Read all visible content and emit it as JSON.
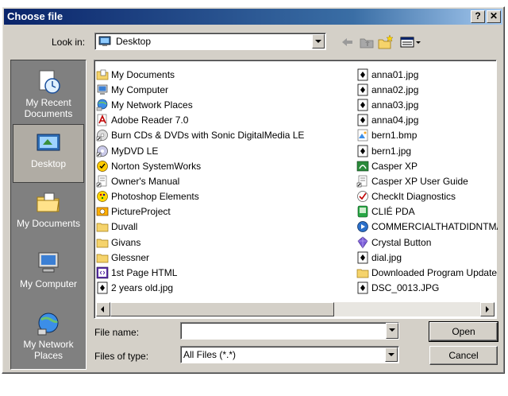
{
  "window": {
    "title": "Choose file",
    "help_label": "?",
    "close_label": "✕"
  },
  "lookin": {
    "label": "Look in:",
    "value": "Desktop"
  },
  "toolbar": {
    "icons": [
      "back-icon",
      "up-folder-icon",
      "new-folder-icon",
      "view-menu-icon"
    ]
  },
  "places": [
    {
      "label": "My Recent Documents",
      "icon": "recent-documents-icon"
    },
    {
      "label": "Desktop",
      "icon": "desktop-icon"
    },
    {
      "label": "My Documents",
      "icon": "my-documents-icon"
    },
    {
      "label": "My Computer",
      "icon": "my-computer-icon"
    },
    {
      "label": "My Network Places",
      "icon": "network-places-icon"
    }
  ],
  "files_col1": [
    {
      "name": "My Documents",
      "icon": "folder-docs-icon"
    },
    {
      "name": "My Computer",
      "icon": "computer-icon"
    },
    {
      "name": "My Network Places",
      "icon": "network-icon"
    },
    {
      "name": "Adobe Reader 7.0",
      "icon": "adobe-icon"
    },
    {
      "name": "Burn CDs & DVDs with Sonic DigitalMedia LE",
      "icon": "cd-shortcut-icon"
    },
    {
      "name": "MyDVD LE",
      "icon": "dvd-shortcut-icon"
    },
    {
      "name": "Norton SystemWorks",
      "icon": "norton-icon"
    },
    {
      "name": "Owner's Manual",
      "icon": "manual-shortcut-icon"
    },
    {
      "name": "Photoshop Elements",
      "icon": "photoshop-icon"
    },
    {
      "name": "PictureProject",
      "icon": "pictureproject-icon"
    },
    {
      "name": "Duvall",
      "icon": "folder-icon"
    },
    {
      "name": "Givans",
      "icon": "folder-icon"
    },
    {
      "name": "Glessner",
      "icon": "folder-icon"
    },
    {
      "name": "1st Page HTML",
      "icon": "html-editor-icon"
    },
    {
      "name": "2 years old.jpg",
      "icon": "jpg-file-icon"
    }
  ],
  "files_col2": [
    {
      "name": "anna01.jpg",
      "icon": "jpg-file-icon"
    },
    {
      "name": "anna02.jpg",
      "icon": "jpg-file-icon"
    },
    {
      "name": "anna03.jpg",
      "icon": "jpg-file-icon"
    },
    {
      "name": "anna04.jpg",
      "icon": "jpg-file-icon"
    },
    {
      "name": "bern1.bmp",
      "icon": "bmp-file-icon"
    },
    {
      "name": "bern1.jpg",
      "icon": "jpg-file-icon"
    },
    {
      "name": "Casper XP",
      "icon": "casper-icon"
    },
    {
      "name": "Casper XP User Guide",
      "icon": "guide-shortcut-icon"
    },
    {
      "name": "CheckIt Diagnostics",
      "icon": "checkit-icon"
    },
    {
      "name": "CLIÉ PDA",
      "icon": "clie-icon"
    },
    {
      "name": "COMMERCIALTHATDIDNTMA",
      "icon": "media-icon"
    },
    {
      "name": "Crystal Button",
      "icon": "crystal-icon"
    },
    {
      "name": "dial.jpg",
      "icon": "jpg-file-icon"
    },
    {
      "name": "Downloaded Program Update",
      "icon": "folder-icon"
    },
    {
      "name": "DSC_0013.JPG",
      "icon": "jpg-file-icon"
    }
  ],
  "filename": {
    "label": "File name:",
    "value": "",
    "placeholder": ""
  },
  "filetype": {
    "label": "Files of type:",
    "value": "All Files (*.*)"
  },
  "buttons": {
    "open": "Open",
    "cancel": "Cancel"
  },
  "colors": {
    "title_start": "#0a246a",
    "title_end": "#a6caf0",
    "face": "#d4d0c8",
    "places_bg": "#808080"
  }
}
